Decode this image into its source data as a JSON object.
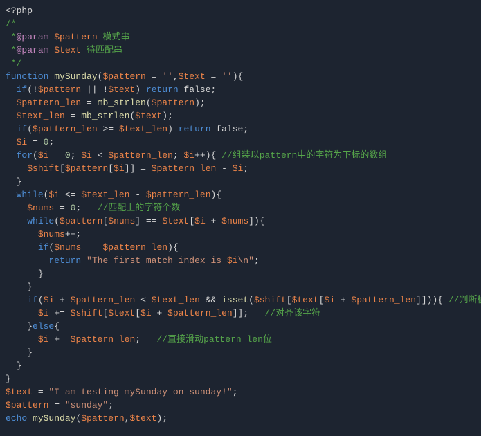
{
  "language": "php",
  "code": {
    "l1": "<?php",
    "l2": "/*",
    "l3a": " *",
    "l3b": "@param",
    "l3c": " $pattern",
    "l3d": " 模式串",
    "l4a": " *",
    "l4b": "@param",
    "l4c": " $text",
    "l4d": " 待匹配串",
    "l5": " */",
    "l6_fn": "function",
    "l6_name": " mySunday",
    "l6_p1": "$pattern",
    "l6_eq": " = ",
    "l6_s1": "''",
    "l6_c": ",",
    "l6_p2": "$text",
    "l6_s2": "''",
    "l6_end": "){",
    "l7_if": "if",
    "l7_open": "(!",
    "l7_v1": "$pattern",
    "l7_or": " || !",
    "l7_v2": "$text",
    "l7_close": ") ",
    "l7_ret": "return",
    "l7_false": " false;",
    "l8_v": "$pattern_len",
    "l8_eq": " = ",
    "l8_fn": "mb_strlen",
    "l8_open": "(",
    "l8_arg": "$pattern",
    "l8_close": ");",
    "l9_v": "$text_len",
    "l9_eq": " = ",
    "l9_fn": "mb_strlen",
    "l9_open": "(",
    "l9_arg": "$text",
    "l9_close": ");",
    "l10_if": "if",
    "l10_open": "(",
    "l10_v1": "$pattern_len",
    "l10_op": " >= ",
    "l10_v2": "$text_len",
    "l10_close": ") ",
    "l10_ret": "return",
    "l10_false": " false;",
    "l11_v": "$i",
    "l11_eq": " = ",
    "l11_n": "0",
    "l11_end": ";",
    "l12_for": "for",
    "l12_open": "(",
    "l12_v1": "$i",
    "l12_eq": " = ",
    "l12_n": "0",
    "l12_sc": "; ",
    "l12_v2": "$i",
    "l12_lt": " < ",
    "l12_v3": "$pattern_len",
    "l12_sc2": "; ",
    "l12_v4": "$i",
    "l12_inc": "++){ ",
    "l12_cm": "//组装以pattern中的字符为下标的数组",
    "l13_v1": "$shift",
    "l13_o1": "[",
    "l13_v2": "$pattern",
    "l13_o2": "[",
    "l13_v3": "$i",
    "l13_o3": "]] = ",
    "l13_v4": "$pattern_len",
    "l13_o4": " - ",
    "l13_v5": "$i",
    "l13_end": ";",
    "l14": "}",
    "l15_while": "while",
    "l15_open": "(",
    "l15_v1": "$i",
    "l15_op": " <= ",
    "l15_v2": "$text_len",
    "l15_m": " - ",
    "l15_v3": "$pattern_len",
    "l15_close": "){",
    "l16_v": "$nums",
    "l16_eq": " = ",
    "l16_n": "0",
    "l16_end": ";   ",
    "l16_cm": "//匹配上的字符个数",
    "l17_while": "while",
    "l17_open": "(",
    "l17_v1": "$pattern",
    "l17_o1": "[",
    "l17_v2": "$nums",
    "l17_o2": "] == ",
    "l17_v3": "$text",
    "l17_o3": "[",
    "l17_v4": "$i",
    "l17_o4": " + ",
    "l17_v5": "$nums",
    "l17_o5": "]){",
    "l18_v": "$nums",
    "l18_inc": "++;",
    "l19_if": "if",
    "l19_open": "(",
    "l19_v1": "$nums",
    "l19_eq": " == ",
    "l19_v2": "$pattern_len",
    "l19_close": "){",
    "l20_ret": "return",
    "l20_sp": " ",
    "l20_s1": "\"The first match index is ",
    "l20_var": "$i",
    "l20_s2": "\\n\"",
    "l20_end": ";",
    "l21": "}",
    "l22": "}",
    "l23_if": "if",
    "l23_open": "(",
    "l23_v1": "$i",
    "l23_p": " + ",
    "l23_v2": "$pattern_len",
    "l23_lt": " < ",
    "l23_v3": "$text_len",
    "l23_and": " && ",
    "l23_isset": "isset",
    "l23_o1": "(",
    "l23_v4": "$shift",
    "l23_o2": "[",
    "l23_v5": "$text",
    "l23_o3": "[",
    "l23_v6": "$i",
    "l23_o4": " + ",
    "l23_v7": "$pattern_len",
    "l23_o5": "]])){ ",
    "l23_cm": "//判断模式串后一位字符是否在模式串中",
    "l24_v1": "$i",
    "l24_pe": " += ",
    "l24_v2": "$shift",
    "l24_o1": "[",
    "l24_v3": "$text",
    "l24_o2": "[",
    "l24_v4": "$i",
    "l24_o3": " + ",
    "l24_v5": "$pattern_len",
    "l24_o4": "]];   ",
    "l24_cm": "//对齐该字符",
    "l25_cb": "}",
    "l25_else": "else",
    "l25_ob": "{",
    "l26_v1": "$i",
    "l26_pe": " += ",
    "l26_v2": "$pattern_len",
    "l26_end": ";   ",
    "l26_cm": "//直接滑动pattern_len位",
    "l27": "}",
    "l28": "}",
    "l29": "}",
    "l30_v": "$text",
    "l30_eq": " = ",
    "l30_s": "\"I am testing mySunday on sunday!\"",
    "l30_end": ";",
    "l31_v": "$pattern",
    "l31_eq": " = ",
    "l31_s": "\"sunday\"",
    "l31_end": ";",
    "l32_echo": "echo",
    "l32_sp": " ",
    "l32_fn": "mySunday",
    "l32_open": "(",
    "l32_v1": "$pattern",
    "l32_c": ",",
    "l32_v2": "$text",
    "l32_close": ");"
  }
}
